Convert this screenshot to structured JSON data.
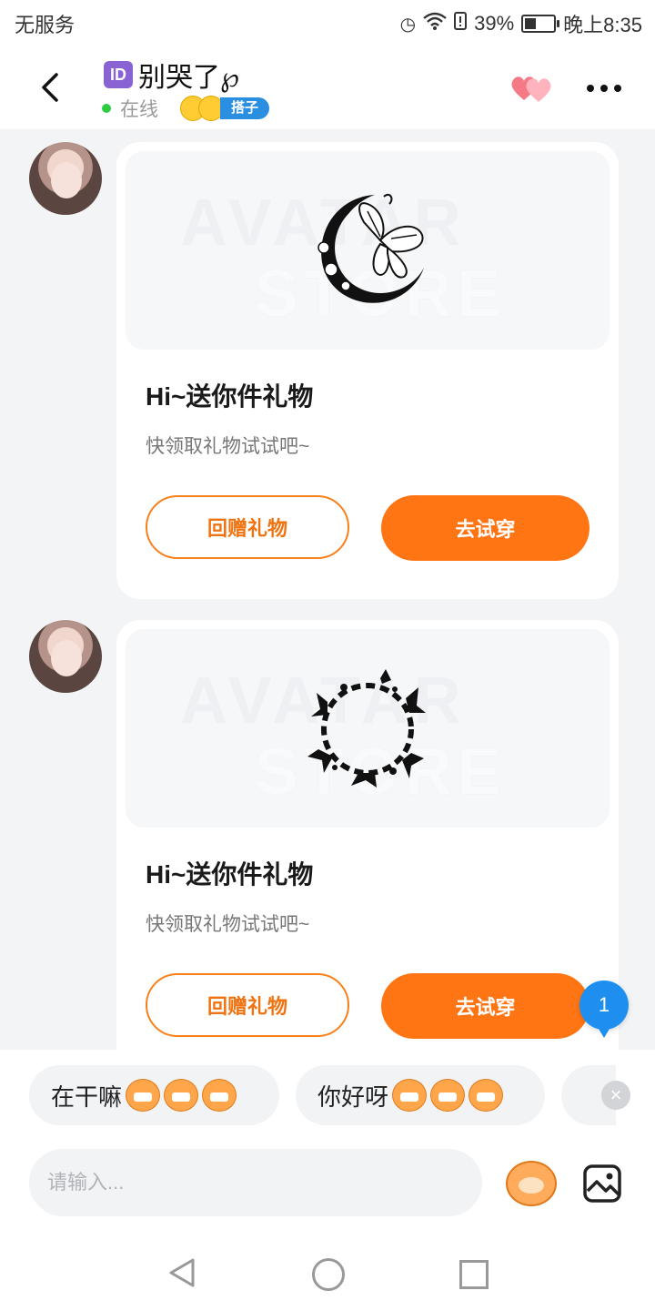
{
  "status_bar": {
    "carrier": "无服务",
    "battery": "39%",
    "time": "晚上8:35",
    "battery_level": 0.39
  },
  "header": {
    "id_badge": "ID",
    "name": "别哭了℘",
    "online": "在线",
    "tag": "搭子"
  },
  "messages": [
    {
      "title": "Hi~送你件礼物",
      "subtitle": "快领取礼物试试吧~",
      "return_gift_label": "回赠礼物",
      "try_on_label": "去试穿",
      "watermark": [
        "AVATAR",
        "STORE"
      ]
    },
    {
      "title": "Hi~送你件礼物",
      "subtitle": "快领取礼物试试吧~",
      "return_gift_label": "回赠礼物",
      "try_on_label": "去试穿",
      "watermark": [
        "AVATAR",
        "STORE"
      ]
    }
  ],
  "unread_count": "1",
  "quick_replies": [
    {
      "text": "在干嘛"
    },
    {
      "text": "你好呀"
    }
  ],
  "input": {
    "placeholder": "请输入..."
  },
  "colors": {
    "accent_orange": "#ff7514",
    "badge_blue": "#1e8fee",
    "online_green": "#2ecc40"
  },
  "icons": {
    "back": "back-arrow-icon",
    "like": "hearts-icon",
    "more": "more-icon",
    "emoji": "emoji-icon",
    "image": "image-icon"
  }
}
